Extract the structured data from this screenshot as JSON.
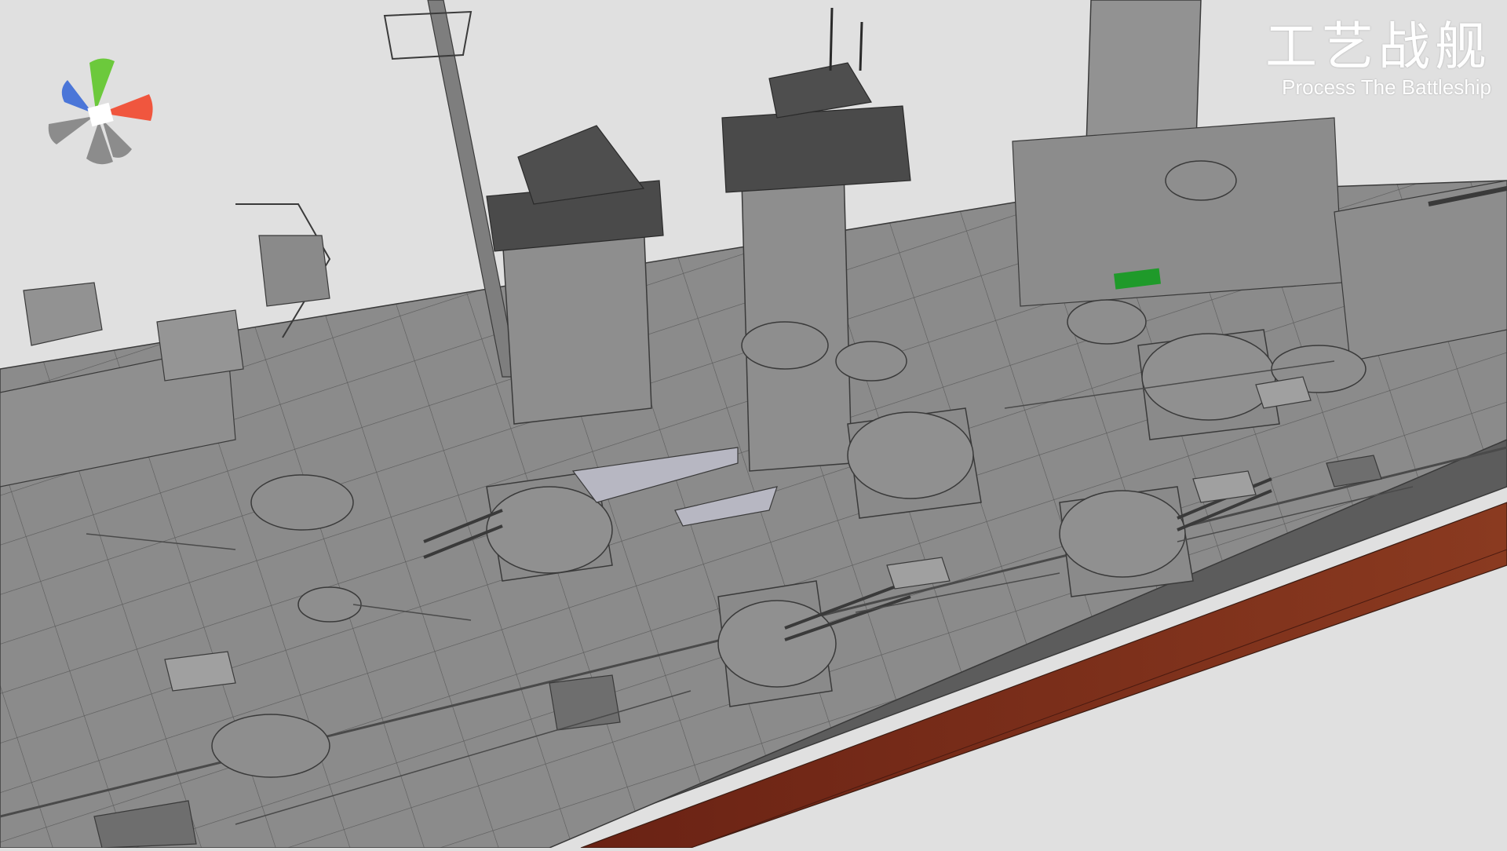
{
  "title": {
    "chinese": "工艺战舰",
    "english": "Process The Battleship"
  },
  "viewport": {
    "background": "#e0e0e0",
    "model": "battleship"
  },
  "axis_gizmo": {
    "colors": {
      "x": "#f0563e",
      "y": "#6cc93c",
      "z": "#4b76d8",
      "negative": "#8c8c8c",
      "center": "#ffffff"
    }
  },
  "colors": {
    "deck": "#8a8a8a",
    "superstructure": "#8f8f8f",
    "roof": "#4a4a4a",
    "hull_band": "#5a5a5a",
    "hull_red": "#7a2a18",
    "edges": "#3a3a3a",
    "highlight": "#1f9a2a"
  }
}
